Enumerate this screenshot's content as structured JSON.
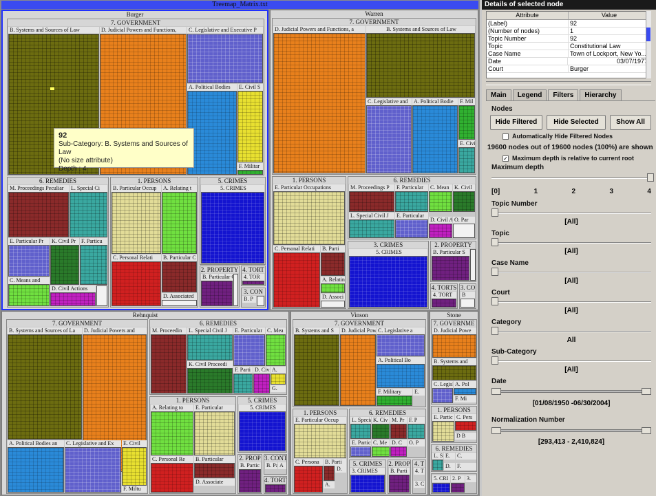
{
  "window_title": "Treemap_Matrix.txt",
  "treemap": {
    "groups": {
      "burger": "Burger",
      "warren": "Warren",
      "rehnquist": "Rehnquist",
      "vinson": "Vinson",
      "stone": "Stone"
    },
    "labels": {
      "gov": "7. GOVERNMENT",
      "gov_short": "7. GOVERNME",
      "remedies": "6. REMEDIES",
      "persons": "1. PERSONS",
      "crimes": "5. CRIMES",
      "crimes3": "3. CRIMES",
      "property": "2. PROPERTY",
      "prop_short": "2. PROP",
      "torts": "4. TORT",
      "torts_full": "4. TORTS",
      "contra": "3. CONTRA",
      "con": "3. CON",
      "co": "3. CO",
      "b_sys": "B. Systems and Sources of Law",
      "b_sys_la": "B. Systems and Sources of La",
      "b_sys_s": "B. Systems and S",
      "b_sys_and": "B. Systems and",
      "d_jud": "D. Judicial Powers and Functions,",
      "d_jud_a": "D. Judicial Powers and Functions, a",
      "d_jud_and": "D. Judicial Powers and",
      "d_jud_pow": "D. Judicial Pow",
      "d_jud_powe": "D. Judicial Powe",
      "c_leg": "C. Legislative and Executive P",
      "c_leg_and": "C. Legislative and",
      "c_leg_ex": "C. Legislative and Ex",
      "c_leg_a": "C. Legislative a",
      "c_legi": "C. Legisl",
      "a_pol": "A. Political Bodies",
      "a_pol_bo": "A. Political Bo",
      "a_pol_an": "A. Political Bodies an",
      "a_pol_s": "A. Pol",
      "a_polb": "A. Political Bodie",
      "e_civ": "E. Civil S",
      "e_civi": "E. Civi",
      "e_civil": "E. Civil",
      "f_mil": "F. Militar",
      "f_milt": "F. Miltu",
      "f_military": "F. Military",
      "f_mil_s": "F. Mil",
      "f_mi": "F. Mi",
      "m_proc": "M. Proceedings Peculiar",
      "m_proc_p": "M. Proceedings P",
      "m_procedin": "M. Proceedin",
      "m_pr": "M. Pr",
      "l_spec": "L. Special Ci",
      "l_spec_j": "L. Special Civil J",
      "l_spec_c": "L. Special",
      "e_part_pr": "E. Particular Pr",
      "k_civ_pr": "K. Civil Pr",
      "f_partic": "F. Particu",
      "f_particular": "F. Particular",
      "f_parti": "F. Parti",
      "c_means": "C. Means and",
      "c_mean": "C. Mean",
      "c_mea": "C. Mea",
      "c_me": "C. Me",
      "d_civ_act": "D. Civil Actions",
      "d_civil_a": "D. Civil A",
      "d_civ": "D. Civi",
      "b_part_occ": "B. Particular Occup",
      "a_rel": "A. Relating t",
      "a_relating": "A. Relating to",
      "a_relatin": "A. Relatin",
      "c_pers": "C. Personal Relati",
      "c_pers_re": "C. Personal Re",
      "c_persona": "C. Persona",
      "b_particular_c": "B. Particular C",
      "b_particular": "B. Particular",
      "b_partic": "B. Particu",
      "b_parti": "B. Parti",
      "b_part_s": "B. Particular S",
      "b_partic_c": "B. Particular C",
      "b_p": "B. P",
      "b_par": "B. Par",
      "b_partie": "B. Partic",
      "d_assoc": "D. Associated",
      "d_associ": "D. Associ",
      "d_associate": "D. Associate",
      "e_part_occ": "E. Particular Occupations",
      "e_particular": "E. Particular",
      "e_part_occup": "E. Particular Occup",
      "e_partic": "E. Partic",
      "e_particu": "E. Particu",
      "k_civil": "K. Civil",
      "k_civ_proc": "K. Civil Proceedi",
      "k_civ": "K. Civ",
      "o_par": "O. Par",
      "c_pers2": "C. Pers",
      "d_c": "D. C",
      "o_p": "O. P",
      "f_p": "F. P",
      "l_s": "L. S",
      "e_s": "E.",
      "c_s": "C.",
      "d_s": "D.",
      "f_s": "F.",
      "a_s": "A.",
      "d_s2": "D.",
      "g_s": "G.",
      "db": "D B",
      "a_small": "A",
      "two_p": "2. P",
      "three": "3.",
      "four_t": "4. T",
      "four_tor": "4. TOR",
      "four_tort": "4. TORT",
      "b_s": "B",
      "i_s": "I",
      "c_small": "C.",
      "five_cri": "5. CRI",
      "two_pr": "2. PROP",
      "four_tc": "4. T",
      "three_c": "3. C"
    },
    "tooltip": {
      "title": "92",
      "line1": "Sub-Category: B. Systems and Sources of Law",
      "line2": "(No size attribute)",
      "line3": "Depth : 4"
    }
  },
  "panel": {
    "title": "Details of selected node",
    "table": {
      "headers": [
        "Attribute",
        "Value"
      ],
      "rows": [
        [
          "(Label)",
          "92"
        ],
        [
          "(Number of nodes)",
          "1"
        ],
        [
          "Topic Number",
          "92"
        ],
        [
          "Topic",
          "Constitutional Law"
        ],
        [
          "Case Name",
          "Town of Lockport, New Yo..."
        ],
        [
          "Date",
          "03/07/1977"
        ],
        [
          "Court",
          "Burger"
        ]
      ]
    },
    "tabs": [
      "Main",
      "Legend",
      "Filters",
      "Hierarchy"
    ],
    "nodes_label": "Nodes",
    "buttons": {
      "hide_filtered": "Hide Filtered",
      "hide_selected": "Hide Selected",
      "show_all": "Show All"
    },
    "auto_hide": "Automatically Hide Filtered Nodes",
    "status": "19600 nodes out of  19600 nodes  (100%) are shown",
    "max_depth_rel": "Maximum depth is relative to current root",
    "max_depth": "Maximum depth",
    "depth_ticks": [
      "[0]",
      "1",
      "2",
      "3",
      "4"
    ],
    "filters": [
      {
        "label": "Topic Number",
        "value": "[All]"
      },
      {
        "label": "Topic",
        "value": "[All]"
      },
      {
        "label": "Case Name",
        "value": "[All]"
      },
      {
        "label": "Court",
        "value": "[All]"
      },
      {
        "label": "Category",
        "value": "All"
      },
      {
        "label": "Sub-Category",
        "value": "[All]"
      }
    ],
    "date": {
      "label": "Date",
      "value": "[01/08/1950 -06/30/2004]"
    },
    "norm": {
      "label": "Normalization Number",
      "value": "[293,413 - 2,410,824]"
    }
  }
}
